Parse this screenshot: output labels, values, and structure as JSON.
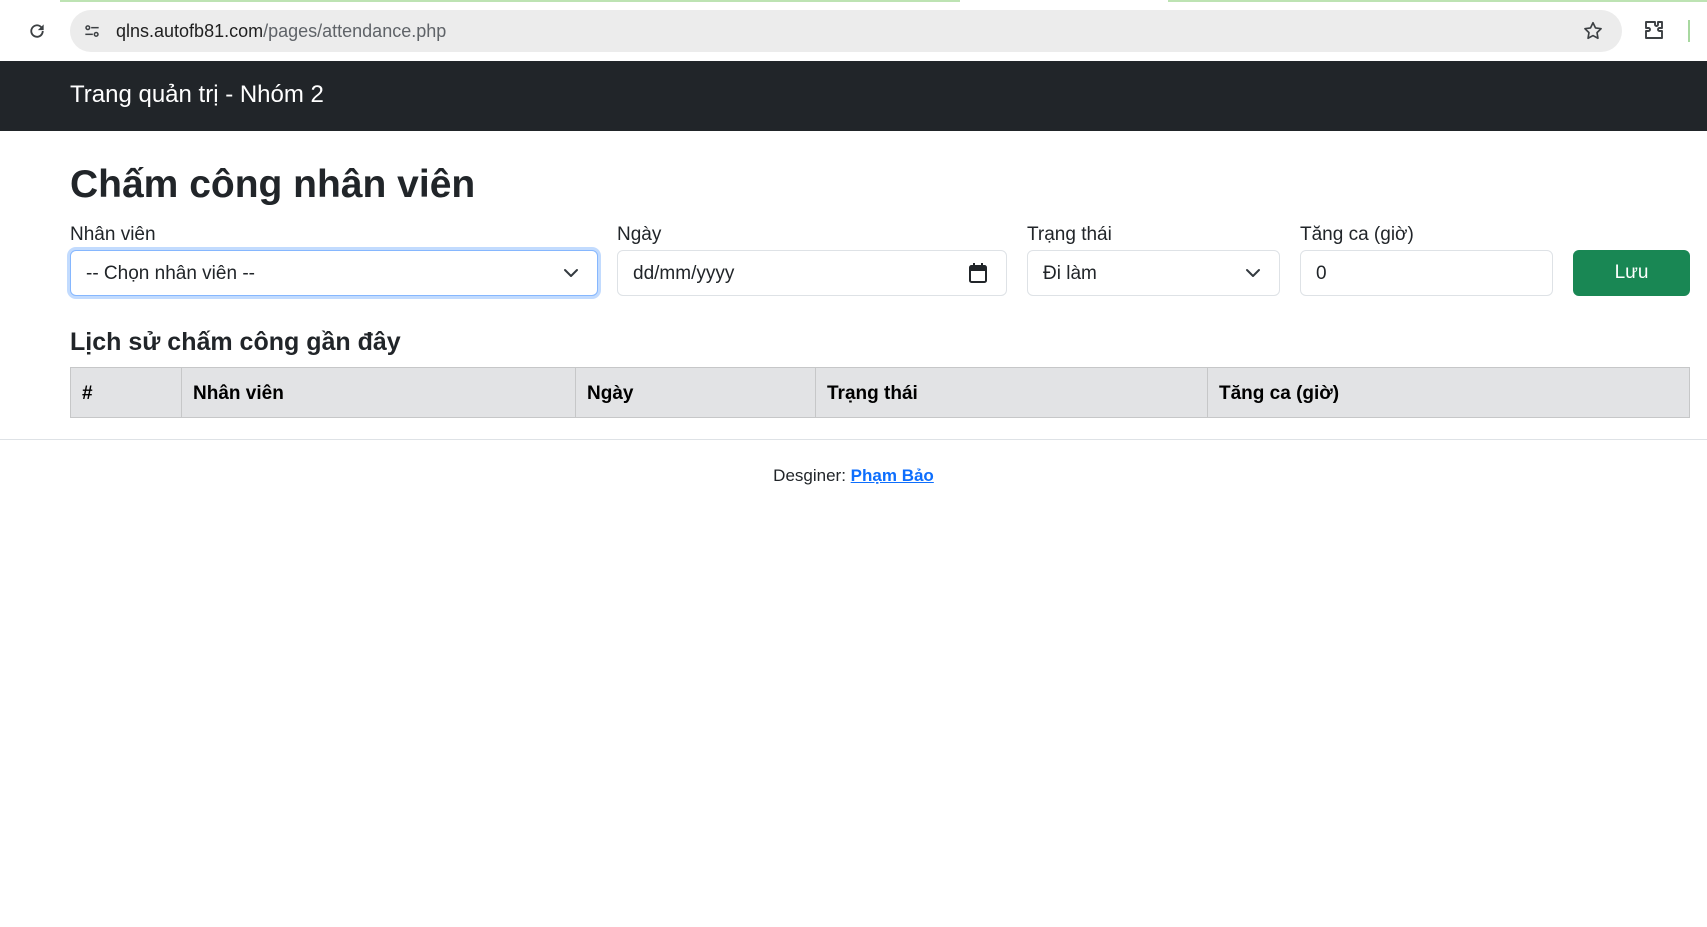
{
  "browser": {
    "url_host": "qlns.autofb81.com",
    "url_path": "/pages/attendance.php"
  },
  "navbar": {
    "brand": "Trang quản trị - Nhóm 2"
  },
  "page": {
    "title": "Chấm công nhân viên"
  },
  "form": {
    "employee": {
      "label": "Nhân viên",
      "value": "-- Chọn nhân viên --"
    },
    "date": {
      "label": "Ngày",
      "placeholder": "dd/mm/yyyy"
    },
    "status": {
      "label": "Trạng thái",
      "value": "Đi làm"
    },
    "overtime": {
      "label": "Tăng ca (giờ)",
      "value": "0"
    },
    "save_label": "Lưu"
  },
  "history": {
    "title": "Lịch sử chấm công gần đây",
    "columns": [
      "#",
      "Nhân viên",
      "Ngày",
      "Trạng thái",
      "Tăng ca (giờ)"
    ],
    "rows": []
  },
  "footer": {
    "prefix": "Desginer:",
    "author": "Phạm Bảo"
  },
  "colors": {
    "navbar_bg": "#212529",
    "save_button": "#198754",
    "table_header_bg": "#e2e3e5",
    "link": "#0d6efd"
  }
}
